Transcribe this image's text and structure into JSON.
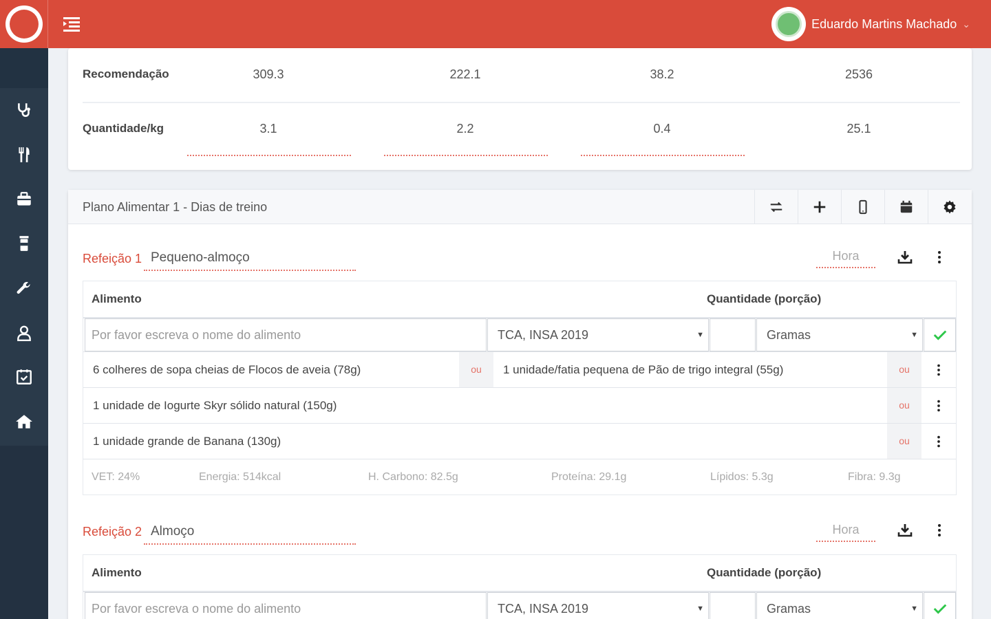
{
  "header": {
    "user_name": "Eduardo Martins Machado",
    "caret": "⌄",
    "brand_color": "#d94b3a"
  },
  "sidebar": {
    "items": [
      {
        "icon": "stethoscope-icon"
      },
      {
        "icon": "utensils-icon"
      },
      {
        "icon": "toolbox-icon"
      },
      {
        "icon": "jar-icon"
      },
      {
        "icon": "wrench-icon"
      },
      {
        "icon": "user-icon"
      },
      {
        "icon": "calendar-check-icon"
      },
      {
        "icon": "home-icon"
      }
    ]
  },
  "recommendation": {
    "rows": [
      {
        "label": "Recomendação",
        "values": [
          "309.3",
          "222.1",
          "38.2",
          "2536"
        ]
      },
      {
        "label": "Quantidade/kg",
        "values": [
          "3.1",
          "2.2",
          "0.4",
          "25.1"
        ]
      }
    ]
  },
  "plan": {
    "title": "Plano Alimentar 1 -  Dias de treino",
    "buttons": [
      "swap-icon",
      "plus-icon",
      "mobile-icon",
      "calendar-icon",
      "gear-icon"
    ]
  },
  "meals": [
    {
      "label": "Refeição 1",
      "name": "Pequeno-almoço",
      "hour_placeholder": "Hora",
      "col_food": "Alimento",
      "col_qty": "Quantidade (porção)",
      "search_placeholder": "Por favor escreva o nome do alimento",
      "database": "TCA, INSA 2019",
      "unit": "Gramas",
      "foods": [
        {
          "text": "6 colheres de sopa cheias de Flocos de aveia (78g)",
          "alt": "1 unidade/fatia pequena de Pão de trigo integral (55g)"
        },
        {
          "text": "1 unidade de Iogurte Skyr sólido natural (150g)"
        },
        {
          "text": "1 unidade grande de Banana (130g)"
        }
      ],
      "or_label": "ou",
      "stats": {
        "vet": "VET: 24%",
        "energy": "Energia: 514kcal",
        "carbs": "H. Carbono: 82.5g",
        "protein": "Proteína: 29.1g",
        "lipids": "Lípidos: 5.3g",
        "fiber": "Fibra: 9.3g"
      }
    },
    {
      "label": "Refeição 2",
      "name": "Almoço",
      "hour_placeholder": "Hora",
      "col_food": "Alimento",
      "col_qty": "Quantidade (porção)",
      "search_placeholder": "Por favor escreva o nome do alimento",
      "database": "TCA, INSA 2019",
      "unit": "Gramas"
    }
  ]
}
